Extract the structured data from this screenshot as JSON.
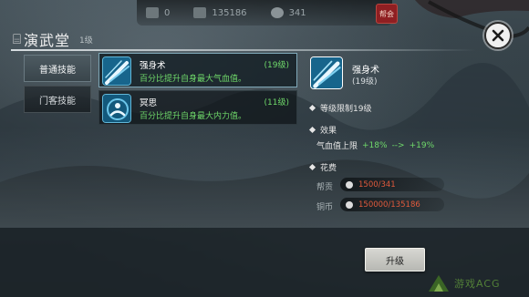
{
  "topbar": {
    "resources": [
      {
        "icon": "resource-icon",
        "value": "0"
      },
      {
        "icon": "coin-icon",
        "value": "135186"
      },
      {
        "icon": "gem-icon",
        "value": "341"
      }
    ],
    "badge_label": "帮会"
  },
  "header": {
    "icon": "hall-icon",
    "title": "演武堂",
    "level": "1级"
  },
  "tabs": [
    {
      "label": "普通技能",
      "active": true
    },
    {
      "label": "门客技能",
      "active": false
    }
  ],
  "skills": [
    {
      "name": "强身术",
      "level": "(19级)",
      "desc": "百分比提升自身最大气血值。",
      "active": true
    },
    {
      "name": "冥思",
      "level": "(11级)",
      "desc": "百分比提升自身最大内力值。",
      "active": false
    }
  ],
  "detail": {
    "name": "强身术",
    "level": "(19级)",
    "level_limit": "等级限制19级",
    "effect_heading": "效果",
    "effect_label": "气血值上限",
    "effect_from": "+18%",
    "effect_arrow": "-->",
    "effect_to": "+19%",
    "cost_heading": "花费",
    "costs": [
      {
        "label": "帮贡",
        "value": "1500/341"
      },
      {
        "label": "铜币",
        "value": "150000/135186"
      }
    ]
  },
  "upgrade_label": "升级",
  "watermark_text": "游戏ACG"
}
